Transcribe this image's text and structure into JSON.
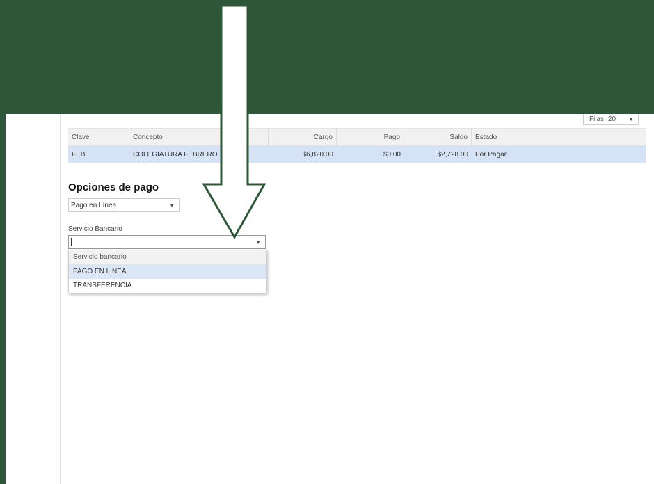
{
  "rows_control": {
    "label": "Filas:",
    "value": "20"
  },
  "table": {
    "headers": [
      "Clave",
      "Concepto",
      "Cargo",
      "Pago",
      "Saldo",
      "Estado"
    ],
    "rows": [
      [
        "FEB",
        "COLEGIATURA FEBRERO",
        "$6,820.00",
        "$0.00",
        "$2,728.00",
        "Por Pagar"
      ]
    ]
  },
  "payment_options": {
    "title": "Opciones de pago",
    "method_selected": "Pago en Línea",
    "bank_label": "Servicio Bancario",
    "bank_value": "",
    "bank_options": [
      "Servicio bancario",
      "PAGO EN LINEA",
      "TRANSFERENCIA"
    ]
  },
  "colors": {
    "background": "#2e5739",
    "arrow_outline": "#2e5739",
    "selected_row": "#d6e3f7",
    "highlight_option": "#dbe6f6"
  },
  "icons": [
    "chevron-down-icon",
    "down-arrow-annotation-icon"
  ]
}
